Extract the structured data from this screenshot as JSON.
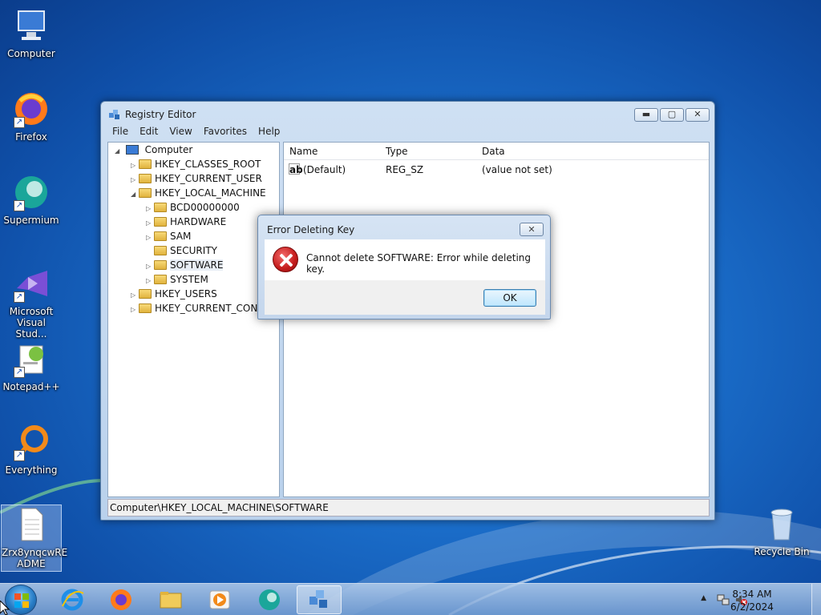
{
  "desktop": {
    "icons": [
      {
        "label": "Computer"
      },
      {
        "label": "Firefox"
      },
      {
        "label": "Supermium"
      },
      {
        "label": "Microsoft Visual Stud..."
      },
      {
        "label": "Notepad++"
      },
      {
        "label": "Everything"
      },
      {
        "label": "Zrx8ynqcwRE ADME"
      },
      {
        "label": "Recycle Bin"
      }
    ]
  },
  "window": {
    "title": "Registry Editor",
    "buttons": {
      "minimize": "▬",
      "maximize": "▢",
      "close": "✕"
    },
    "menu": [
      "File",
      "Edit",
      "View",
      "Favorites",
      "Help"
    ],
    "tree": [
      {
        "label": "Computer"
      },
      {
        "label": "HKEY_CLASSES_ROOT"
      },
      {
        "label": "HKEY_CURRENT_USER"
      },
      {
        "label": "HKEY_LOCAL_MACHINE"
      },
      {
        "label": "BCD00000000"
      },
      {
        "label": "HARDWARE"
      },
      {
        "label": "SAM"
      },
      {
        "label": "SECURITY"
      },
      {
        "label": "SOFTWARE"
      },
      {
        "label": "SYSTEM"
      },
      {
        "label": "HKEY_USERS"
      },
      {
        "label": "HKEY_CURRENT_CONFIG"
      }
    ],
    "columns": [
      "Name",
      "Type",
      "Data"
    ],
    "rows": [
      {
        "name": "(Default)",
        "type": "REG_SZ",
        "data": "(value not set)",
        "icon": "ab"
      }
    ],
    "status": "Computer\\HKEY_LOCAL_MACHINE\\SOFTWARE"
  },
  "dialog": {
    "title": "Error Deleting Key",
    "close": "✕",
    "message": "Cannot delete SOFTWARE:  Error while deleting key.",
    "ok": "OK"
  },
  "taskbar": {
    "time": "8:34 AM",
    "date": "6/2/2024",
    "tray_chevron": "▲"
  },
  "colors": {
    "accent": "#1a6cc8",
    "error": "#c41c1c"
  }
}
